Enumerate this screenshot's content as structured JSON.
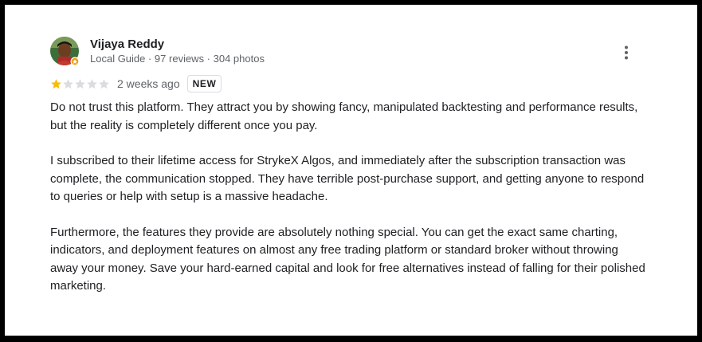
{
  "review": {
    "author": "Vijaya Reddy",
    "meta": "Local Guide · 97 reviews · 304 photos",
    "rating": 1,
    "max_rating": 5,
    "date": "2 weeks ago",
    "badge": "NEW",
    "paragraphs": [
      "Do not trust this platform. They attract you by showing fancy, manipulated backtesting and performance results, but the reality is completely different once you pay.",
      "I subscribed to their lifetime access for StrykeX Algos, and immediately after the subscription transaction was complete, the communication stopped. They have terrible post-purchase support, and getting anyone to respond to queries or help with setup is a massive headache.",
      "Furthermore, the features they provide are absolutely nothing special. You can get the exact same charting, indicators, and deployment features on almost any free trading platform or standard broker without throwing away your money. Save your hard-earned capital and look for free alternatives instead of falling for their polished marketing."
    ]
  },
  "icons": {
    "more": "more-vert-icon",
    "star_filled": "star-filled-icon",
    "star_empty": "star-empty-icon",
    "local_guide": "local-guide-badge-icon"
  },
  "colors": {
    "star_filled": "#fbbc04",
    "star_empty": "#dadce0",
    "text": "#202124",
    "muted": "#5f6368"
  }
}
